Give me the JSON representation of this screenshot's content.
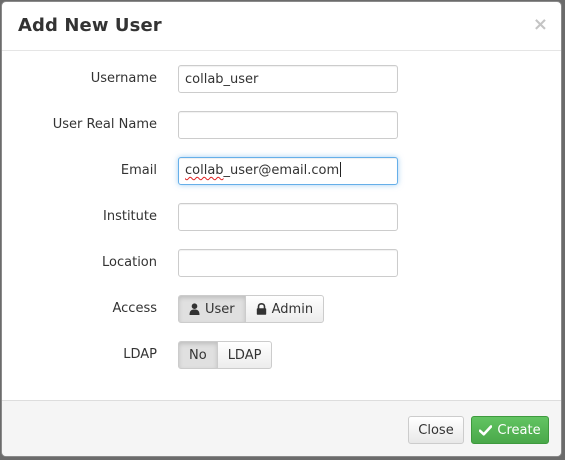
{
  "dialog": {
    "title": "Add New User",
    "close_glyph": "×"
  },
  "form": {
    "username": {
      "label": "Username",
      "value": "collab_user",
      "placeholder": ""
    },
    "real_name": {
      "label": "User Real Name",
      "value": "",
      "placeholder": ""
    },
    "email": {
      "label": "Email",
      "value_misspelled": "collab",
      "value_rest": "_user@email.com",
      "placeholder": ""
    },
    "institute": {
      "label": "Institute",
      "value": "",
      "placeholder": ""
    },
    "location": {
      "label": "Location",
      "value": "",
      "placeholder": ""
    },
    "access": {
      "label": "Access",
      "options": [
        {
          "label": "User",
          "icon": "user-icon",
          "selected": true
        },
        {
          "label": "Admin",
          "icon": "lock-icon",
          "selected": false
        }
      ]
    },
    "ldap": {
      "label": "LDAP",
      "options": [
        {
          "label": "No",
          "selected": true
        },
        {
          "label": "LDAP",
          "selected": false
        }
      ]
    }
  },
  "footer": {
    "close_label": "Close",
    "create_label": "Create",
    "create_icon": "checkmark-icon"
  },
  "colors": {
    "create_button": "#5bb75b",
    "focus_border": "#66afe9",
    "spellcheck_underline": "#e02020"
  }
}
